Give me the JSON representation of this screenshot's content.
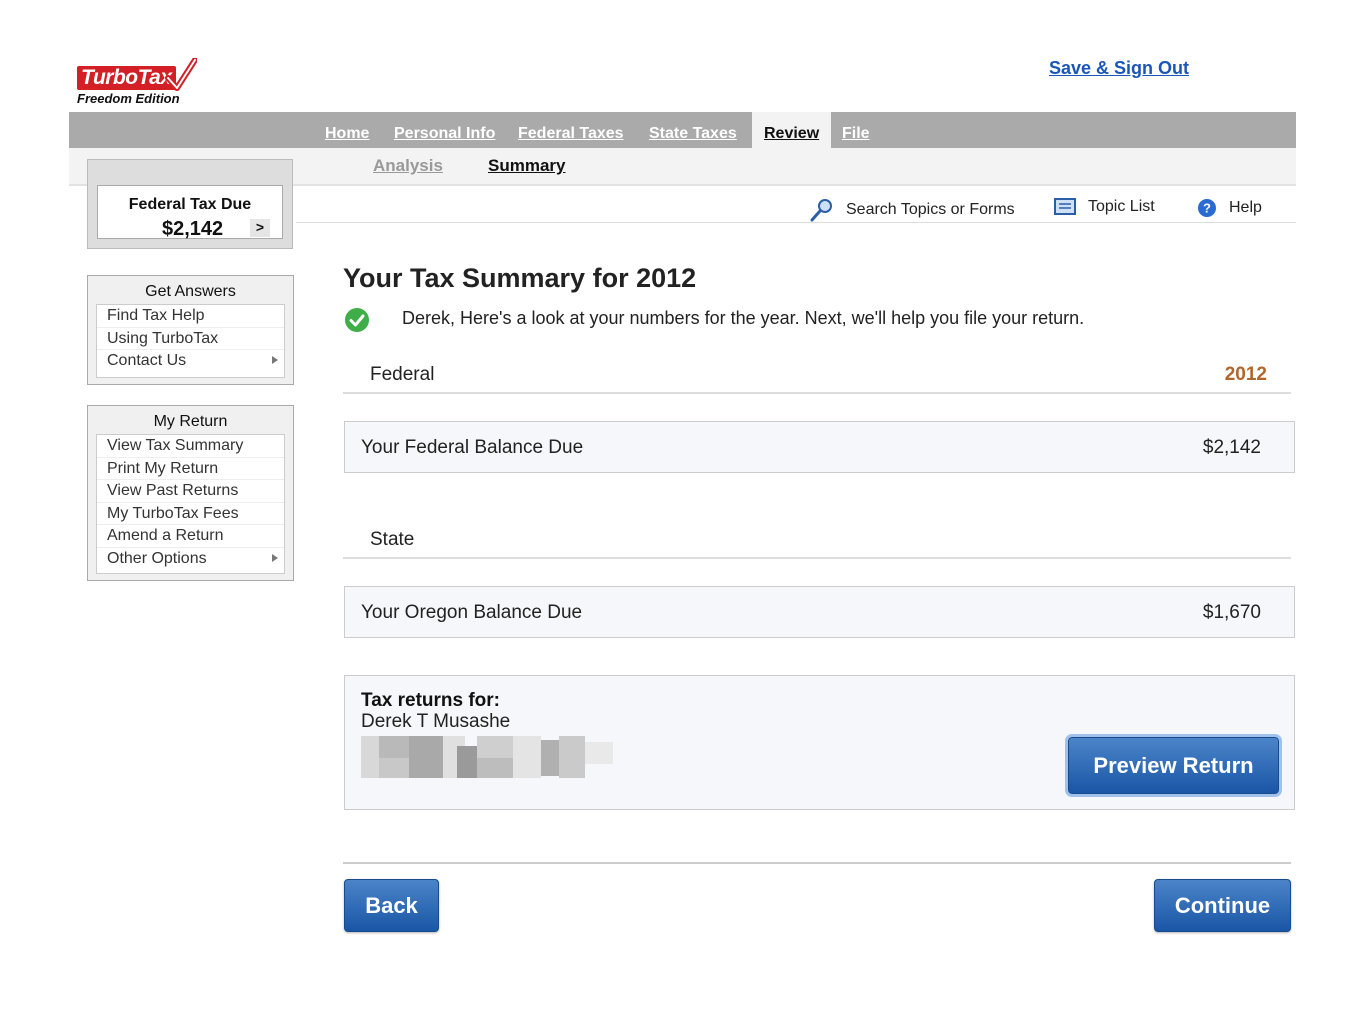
{
  "brand": {
    "logo_text": "TurboTax",
    "edition": "Freedom Edition"
  },
  "header": {
    "save_signout": "Save & Sign Out"
  },
  "nav": {
    "tabs": [
      {
        "label": "Home"
      },
      {
        "label": "Personal Info"
      },
      {
        "label": "Federal Taxes"
      },
      {
        "label": "State Taxes"
      },
      {
        "label": "Review",
        "active": true
      },
      {
        "label": "File"
      }
    ],
    "subtabs": [
      {
        "label": "Analysis"
      },
      {
        "label": "Summary",
        "active": true
      }
    ]
  },
  "tools": {
    "search": "Search Topics or Forms",
    "topic_list": "Topic List",
    "help": "Help"
  },
  "tax_due": {
    "label": "Federal Tax Due",
    "amount": "$2,142",
    "arrow": ">"
  },
  "get_answers": {
    "title": "Get Answers",
    "items": [
      "Find Tax Help",
      "Using TurboTax",
      "Contact Us"
    ]
  },
  "my_return": {
    "title": "My Return",
    "items": [
      "View Tax Summary",
      "Print My Return",
      "View Past Returns",
      "My TurboTax Fees",
      "Amend a Return",
      "Other Options"
    ]
  },
  "main": {
    "title": "Your Tax Summary for 2012",
    "intro": "Derek, Here's a look at your numbers for the year. Next, we'll help you file your return.",
    "federal": {
      "label": "Federal",
      "year": "2012",
      "balance_label": "Your Federal Balance Due",
      "balance_amount": "$2,142"
    },
    "state": {
      "label": "State",
      "balance_label": "Your Oregon Balance Due",
      "balance_amount": "$1,670"
    },
    "returns": {
      "label": "Tax returns for:",
      "name": "Derek T Musashe"
    }
  },
  "buttons": {
    "preview": "Preview Return",
    "back": "Back",
    "continue": "Continue"
  },
  "colors": {
    "accent_blue": "#1a56a6",
    "year_orange": "#b1662b",
    "nav_gray": "#aaaaaa",
    "brand_red": "#d32027"
  }
}
